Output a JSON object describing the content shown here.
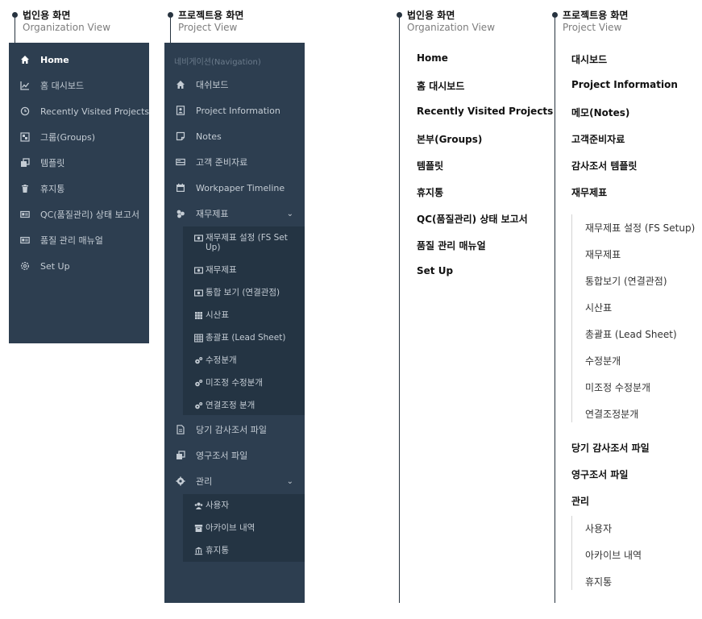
{
  "org_header": {
    "title": "법인용 화면",
    "subtitle": "Organization View"
  },
  "proj_header": {
    "title": "프로젝트용 화면",
    "subtitle": "Project View"
  },
  "org_sidebar": {
    "items": [
      {
        "label": "Home",
        "icon": "home-icon",
        "active": true
      },
      {
        "label": "홈 대시보드",
        "icon": "chart-line-icon"
      },
      {
        "label": "Recently Visited Projects",
        "icon": "clock-icon"
      },
      {
        "label": "그룹(Groups)",
        "icon": "group-icon"
      },
      {
        "label": "템플릿",
        "icon": "clone-icon"
      },
      {
        "label": "휴지통",
        "icon": "trash-icon"
      },
      {
        "label": "QC(품질관리) 상태 보고서",
        "icon": "id-card-icon"
      },
      {
        "label": "품질 관리 매뉴얼",
        "icon": "id-card-icon"
      },
      {
        "label": "Set Up",
        "icon": "gear-outline-icon"
      }
    ]
  },
  "proj_sidebar": {
    "nav_label": "네비게이션(Navigation)",
    "items": [
      {
        "label": "대쉬보드",
        "icon": "home-icon"
      },
      {
        "label": "Project Information",
        "icon": "user-card-icon"
      },
      {
        "label": "Notes",
        "icon": "note-icon"
      },
      {
        "label": "고객 준비자료",
        "icon": "hdd-icon"
      },
      {
        "label": "Workpaper Timeline",
        "icon": "calendar-icon"
      },
      {
        "label": "재무제표",
        "icon": "cubes-icon"
      }
    ],
    "fs_sub": [
      {
        "label": "재무제표 설정 (FS Set Up)",
        "icon": "money-icon"
      },
      {
        "label": "재무제표",
        "icon": "money-icon"
      },
      {
        "label": "통합 보기 (연결관점)",
        "icon": "money-icon"
      },
      {
        "label": "시산표",
        "icon": "grid-icon"
      },
      {
        "label": "총괄표 (Lead Sheet)",
        "icon": "table-icon"
      },
      {
        "label": "수정분개",
        "icon": "cogs-icon"
      },
      {
        "label": "미조정 수정분개",
        "icon": "cogs-icon"
      },
      {
        "label": "연결조정 분개",
        "icon": "cogs-icon"
      }
    ],
    "items2": [
      {
        "label": "당기 감사조서 파일",
        "icon": "file-icon"
      },
      {
        "label": "영구조서 파일",
        "icon": "clone-icon"
      },
      {
        "label": "관리",
        "icon": "gear-icon"
      }
    ],
    "admin_sub": [
      {
        "label": "사용자",
        "icon": "users-icon"
      },
      {
        "label": "아카이브 내역",
        "icon": "archive-icon"
      },
      {
        "label": "휴지통",
        "icon": "bank-icon"
      }
    ],
    "chevron": "⌄"
  },
  "org_list": {
    "header": {
      "title": "법인용 화면",
      "subtitle": "Organization View"
    },
    "items": [
      "Home",
      "홈 대시보드",
      "Recently Visited Projects",
      "본부(Groups)",
      "템플릿",
      "휴지통",
      "QC(품질관리) 상태 보고서",
      "품질 관리 매뉴얼",
      "Set Up"
    ]
  },
  "proj_list": {
    "header": {
      "title": "프로젝트용 화면",
      "subtitle": "Project View"
    },
    "items_top": [
      "대시보드",
      "Project Information",
      "메모(Notes)",
      "고객준비자료",
      "감사조서 템플릿",
      "재무제표"
    ],
    "fs_sub": [
      "재무제표 설정 (FS Setup)",
      "재무제표",
      "통합보기 (연결관점)",
      "시산표",
      "총괄표 (Lead Sheet)",
      "수정분개",
      "미조정 수정분개",
      "연결조정분개"
    ],
    "items_mid": [
      "당기 감사조서 파일",
      "영구조서 파일",
      "관리"
    ],
    "admin_sub": [
      "사용자",
      "아카이브 내역",
      "휴지통"
    ]
  },
  "colors": {
    "panel_bg": "#2d3e50",
    "submenu_bg": "#243443",
    "text_muted": "#c4ccd4",
    "accent_line": "#27333f"
  }
}
